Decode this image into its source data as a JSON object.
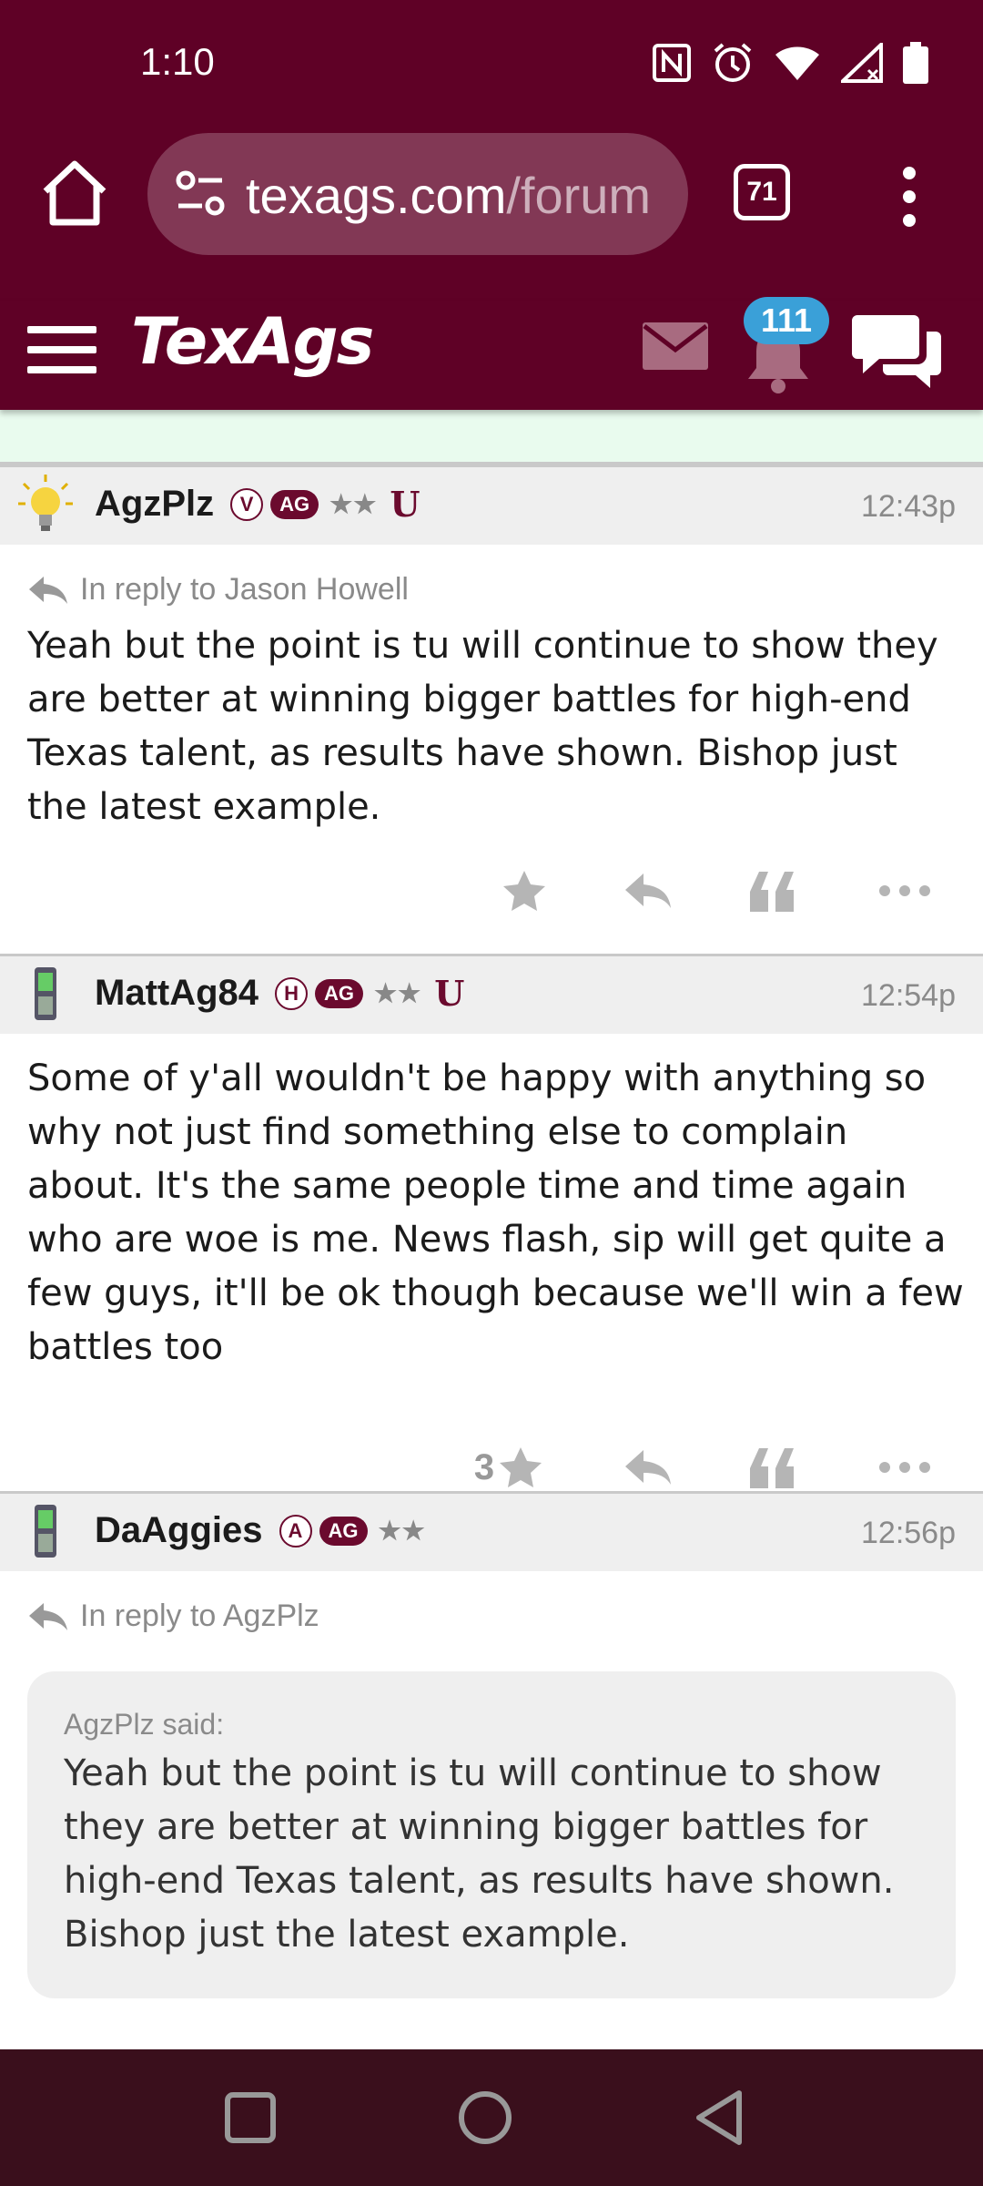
{
  "status_bar": {
    "time": "1:10",
    "icons": [
      "nfc-icon",
      "alarm-icon",
      "wifi-icon",
      "signal-icon",
      "battery-icon"
    ]
  },
  "browser": {
    "url_domain": "texags.com",
    "url_path": "/forum",
    "tab_count": "71"
  },
  "site_header": {
    "logo": "TexAgs",
    "notification_count": "111",
    "colors": {
      "maroon": "#5f0126",
      "badge": "#3aa0d8"
    }
  },
  "posts": [
    {
      "username": "AgzPlz",
      "badge_letter": "V",
      "badge_ag": "AG",
      "stars": "★★",
      "u_logo": "U",
      "time": "12:43p",
      "reply_to": "In reply to Jason Howell",
      "body": "Yeah but the point is tu will continue to show they are better at winning bigger battles for high-end Texas talent, as results have shown. Bishop just the latest example.",
      "star_count": ""
    },
    {
      "username": "MattAg84",
      "badge_letter": "H",
      "badge_ag": "AG",
      "stars": "★★",
      "u_logo": "U",
      "time": "12:54p",
      "body": "Some of y'all wouldn't be happy with anything so why not just find something else to complain about. It's the same people time and time again who are woe is me. News flash, sip will get quite a few guys, it'll be ok though because we'll win a few battles too",
      "star_count": "3"
    },
    {
      "username": "DaAggies",
      "badge_letter": "A",
      "badge_ag": "AG",
      "stars": "★★",
      "time": "12:56p",
      "reply_to": "In reply to AgzPlz",
      "quote_author": "AgzPlz said:",
      "quote_text": "Yeah but the point is tu will continue to show they are better at winning bigger battles for high-end Texas talent, as results have shown. Bishop just the latest example."
    }
  ]
}
